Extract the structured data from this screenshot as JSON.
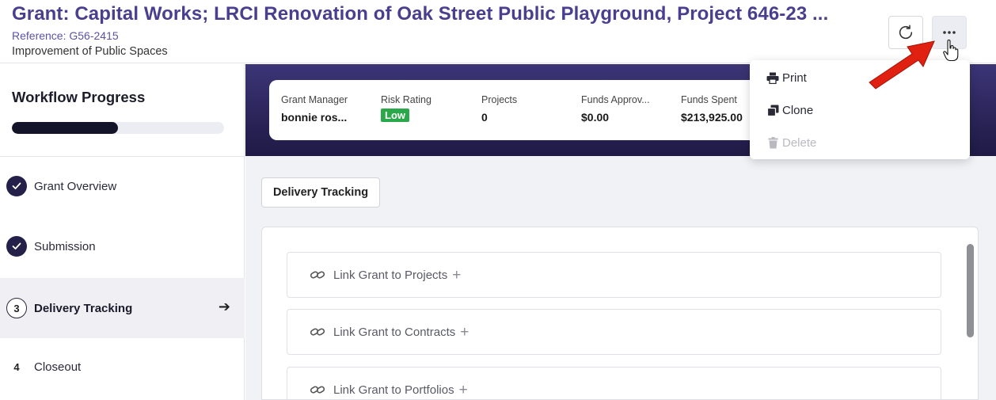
{
  "header": {
    "title": "Grant: Capital Works; LRCI Renovation of Oak Street Public Playground, Project 646-23 ...",
    "reference": "Reference: G56-2415",
    "subtitle": "Improvement of Public Spaces",
    "refresh_icon": "refresh-icon",
    "more_icon": "more-horizontal-icon"
  },
  "sidebar": {
    "title": "Workflow Progress",
    "progress_fraction": 0.5,
    "steps": [
      {
        "marker": "check",
        "label": "Grant Overview",
        "state": "done"
      },
      {
        "marker": "check",
        "label": "Submission",
        "state": "done"
      },
      {
        "marker": "3",
        "label": "Delivery Tracking",
        "state": "active"
      },
      {
        "marker": "4",
        "label": "Closeout",
        "state": "pending"
      }
    ]
  },
  "stats": [
    {
      "label": "Grant Manager",
      "value": "bonnie ros..."
    },
    {
      "label": "Risk Rating",
      "value": "Low"
    },
    {
      "label": "Projects",
      "value": "0"
    },
    {
      "label": "Funds Approv...",
      "value": "$0.00"
    },
    {
      "label": "Funds Spent",
      "value": "$213,925.00"
    }
  ],
  "main": {
    "tab_label": "Delivery Tracking",
    "links": [
      {
        "label": "Link Grant to Projects",
        "icon": "link-icon"
      },
      {
        "label": "Link Grant to Contracts",
        "icon": "link-icon"
      },
      {
        "label": "Link Grant to Portfolios",
        "icon": "link-icon"
      }
    ]
  },
  "menu": {
    "items": [
      {
        "label": "Print",
        "icon": "printer-icon",
        "enabled": true
      },
      {
        "label": "Clone",
        "icon": "clone-icon",
        "enabled": true
      },
      {
        "label": "Delete",
        "icon": "trash-icon",
        "enabled": false
      }
    ]
  },
  "colors": {
    "title": "#4a3f8f",
    "banner": "#2a2458",
    "badge_low": "#2aa84a",
    "progress": "#13132a",
    "annotation_arrow": "#e02010"
  }
}
